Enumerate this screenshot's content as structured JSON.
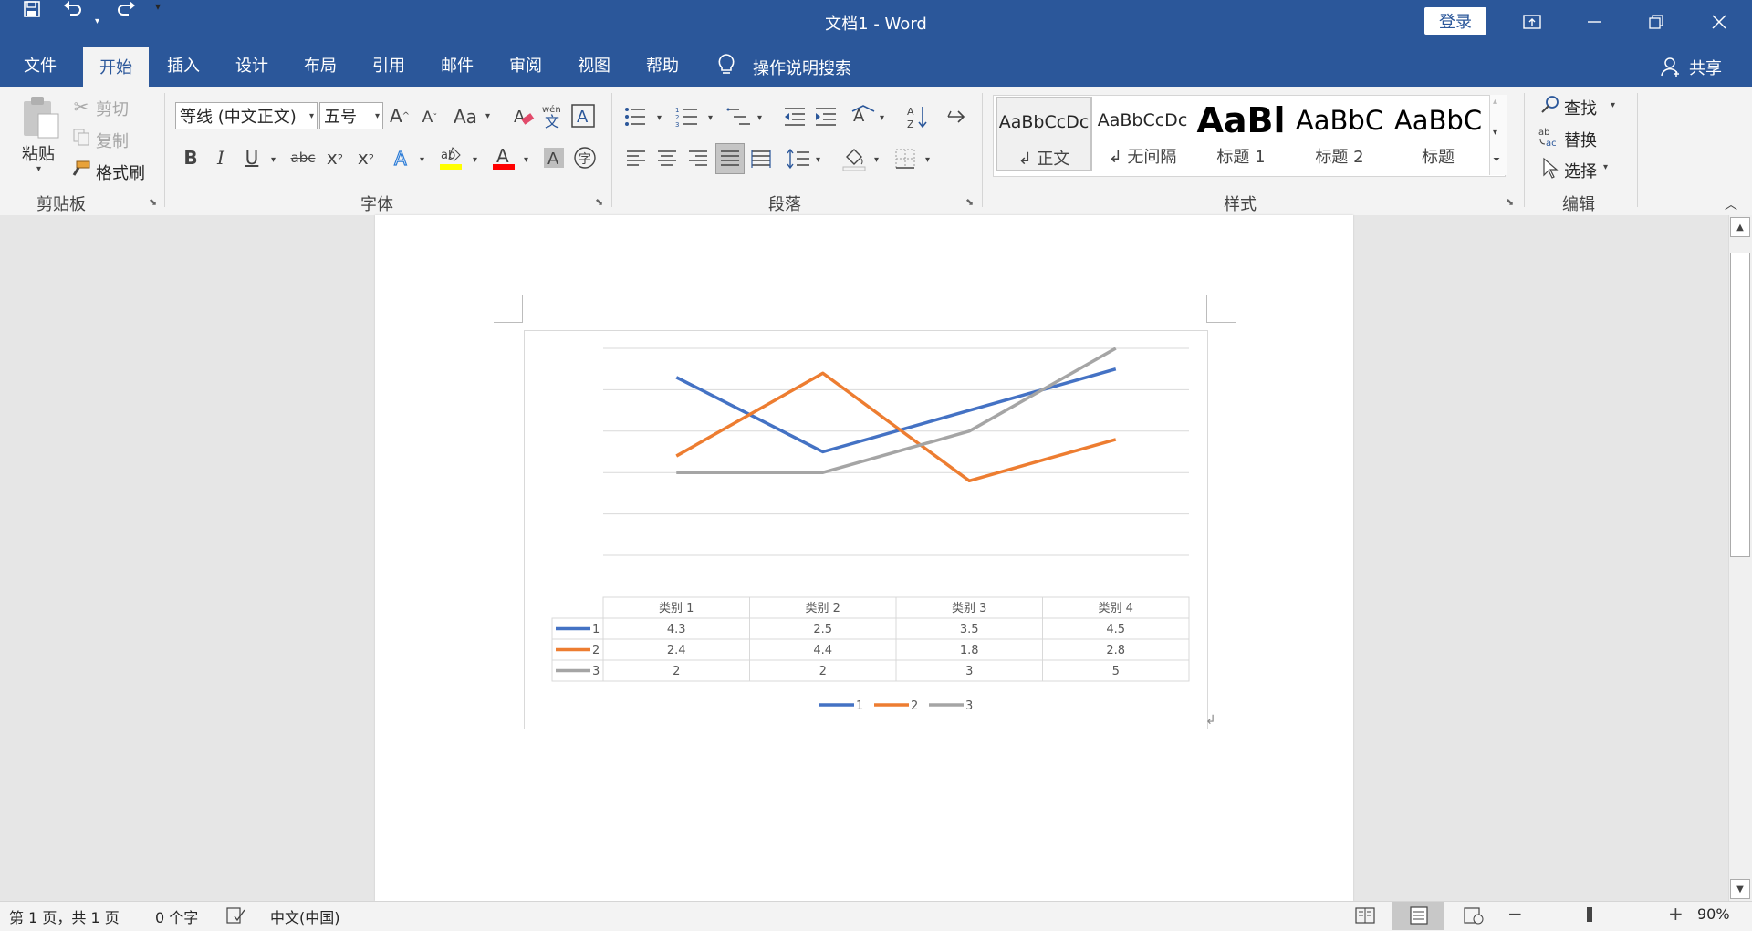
{
  "window": {
    "title": "文档1  -  Word",
    "login_label": "登录"
  },
  "tabs": [
    "文件",
    "开始",
    "插入",
    "设计",
    "布局",
    "引用",
    "邮件",
    "审阅",
    "视图",
    "帮助"
  ],
  "tell_me": "操作说明搜索",
  "share": "共享",
  "clipboard": {
    "paste": "粘贴",
    "cut": "剪切",
    "copy": "复制",
    "format_painter": "格式刷",
    "label": "剪贴板"
  },
  "font": {
    "name": "等线 (中文正文)",
    "size": "五号",
    "label": "字体",
    "case_label": "Aa"
  },
  "paragraph": {
    "label": "段落"
  },
  "styles": {
    "label": "样式",
    "items": [
      {
        "sample": "AaBbCcDc",
        "name": "↲ 正文"
      },
      {
        "sample": "AaBbCcDc",
        "name": "↲ 无间隔"
      },
      {
        "sample": "AaBl",
        "name": "标题 1"
      },
      {
        "sample": "AaBbC",
        "name": "标题 2"
      },
      {
        "sample": "AaBbC",
        "name": "标题"
      }
    ]
  },
  "editing": {
    "find": "查找",
    "replace": "替换",
    "select": "选择",
    "label": "编辑"
  },
  "chart_data": {
    "type": "line",
    "categories": [
      "类别 1",
      "类别 2",
      "类别 3",
      "类别 4"
    ],
    "series": [
      {
        "name": "1",
        "values": [
          4.3,
          2.5,
          3.5,
          4.5
        ],
        "color": "#4472c4"
      },
      {
        "name": "2",
        "values": [
          2.4,
          4.4,
          1.8,
          2.8
        ],
        "color": "#ed7d31"
      },
      {
        "name": "3",
        "values": [
          2,
          2,
          3,
          5
        ],
        "color": "#a5a5a5"
      }
    ],
    "ylim": [
      0,
      5
    ],
    "grid": true,
    "data_table": true,
    "legend": "bottom"
  },
  "status": {
    "page": "第 1 页，共 1 页",
    "words": "0 个字",
    "language": "中文(中国)",
    "zoom": "90%"
  }
}
